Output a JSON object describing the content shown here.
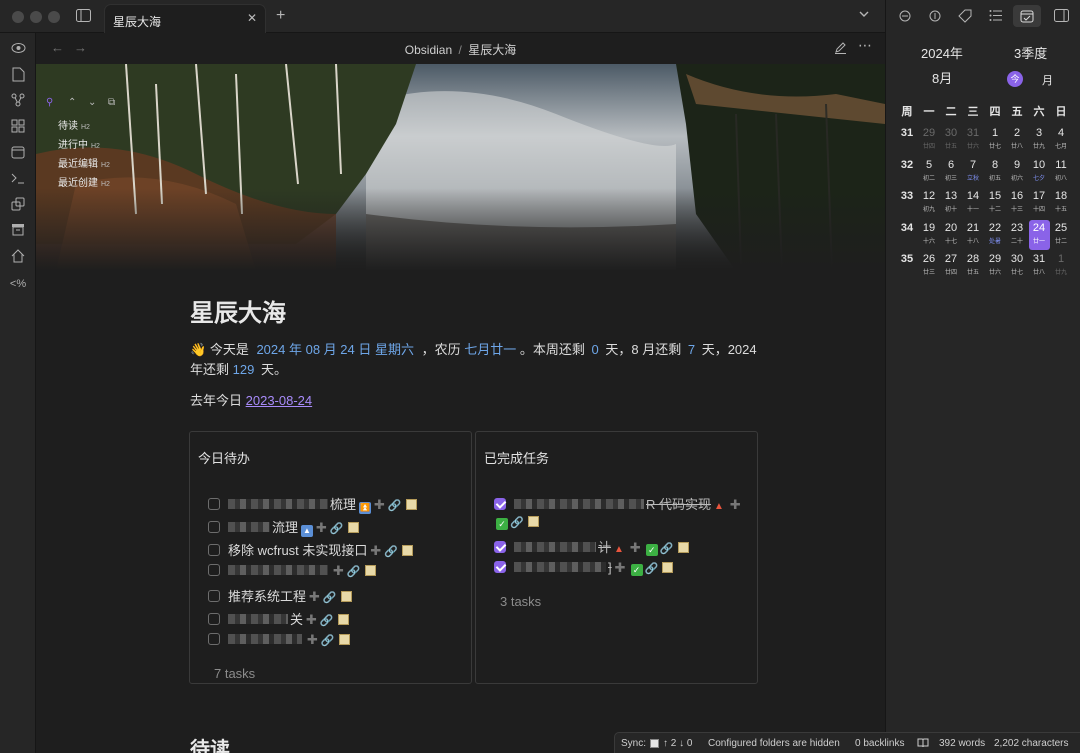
{
  "tab": {
    "title": "星辰大海",
    "close": "✕",
    "new": "+"
  },
  "header": {
    "breadcrumb_parent": "Obsidian",
    "breadcrumb_sep": "/",
    "breadcrumb_current": "星辰大海"
  },
  "outline": {
    "items": [
      {
        "label": "待读",
        "level": "H2"
      },
      {
        "label": "进行中",
        "level": "H2"
      },
      {
        "label": "最近编辑",
        "level": "H2"
      },
      {
        "label": "最近创建",
        "level": "H2"
      }
    ]
  },
  "note": {
    "title": "星辰大海",
    "line1_wave": "👋",
    "line1_a": "今天是",
    "line1_date": "2024 年 08 月 24 日 星期六",
    "line1_b": "，农历",
    "line1_lunar": "七月廿一",
    "line1_c": "。本周还剩",
    "line1_week": "0",
    "line1_d": "天，8 月还剩",
    "line1_month": "7",
    "line1_e": "天，2024",
    "line2_a": "年还剩",
    "line2_year": "129",
    "line2_b": "天。",
    "lastyear_label": "去年今日",
    "lastyear_link": "2023-08-24",
    "next_heading": "待读"
  },
  "todo": {
    "title": "今日待办",
    "tasks": [
      {
        "text": "梳理"
      },
      {
        "text": "流理"
      },
      {
        "text": "移除 wcfrust 未实现接口"
      },
      {
        "text": ""
      },
      {
        "text": "推荐系统工程"
      },
      {
        "text": "关"
      },
      {
        "text": ""
      }
    ],
    "count": "7 tasks"
  },
  "done": {
    "title": "已完成任务",
    "tasks": [
      {
        "text": "R 代码实现"
      },
      {
        "text": "计"
      },
      {
        "text": "]"
      }
    ],
    "count": "3 tasks"
  },
  "calendar": {
    "year": "2024年",
    "quarter": "3季度",
    "month": "8月",
    "today_btn": "今",
    "month_view": "月",
    "weekdays": [
      "周",
      "一",
      "二",
      "三",
      "四",
      "五",
      "六",
      "日"
    ],
    "weeks": [
      {
        "wk": "31",
        "days": [
          [
            "29",
            "廿四",
            1
          ],
          [
            "30",
            "廿五",
            1
          ],
          [
            "31",
            "廿六",
            1
          ],
          [
            "1",
            "廿七",
            0
          ],
          [
            "2",
            "廿八",
            0
          ],
          [
            "3",
            "廿九",
            0
          ],
          [
            "4",
            "七月",
            0
          ]
        ]
      },
      {
        "wk": "32",
        "days": [
          [
            "5",
            "初二",
            0
          ],
          [
            "6",
            "初三",
            0
          ],
          [
            "7",
            "立秋",
            0
          ],
          [
            "8",
            "初五",
            0
          ],
          [
            "9",
            "初六",
            0
          ],
          [
            "10",
            "七夕",
            0
          ],
          [
            "11",
            "初八",
            0
          ]
        ]
      },
      {
        "wk": "33",
        "days": [
          [
            "12",
            "初九",
            0
          ],
          [
            "13",
            "初十",
            0
          ],
          [
            "14",
            "十一",
            0
          ],
          [
            "15",
            "十二",
            0
          ],
          [
            "16",
            "十三",
            0
          ],
          [
            "17",
            "十四",
            0
          ],
          [
            "18",
            "十五",
            0
          ]
        ]
      },
      {
        "wk": "34",
        "days": [
          [
            "19",
            "十六",
            0
          ],
          [
            "20",
            "十七",
            0
          ],
          [
            "21",
            "十八",
            0
          ],
          [
            "22",
            "处暑",
            0
          ],
          [
            "23",
            "二十",
            0
          ],
          [
            "24",
            "廿一",
            0
          ],
          [
            "25",
            "廿二",
            0
          ]
        ]
      },
      {
        "wk": "35",
        "days": [
          [
            "26",
            "廿三",
            0
          ],
          [
            "27",
            "廿四",
            0
          ],
          [
            "28",
            "廿五",
            0
          ],
          [
            "29",
            "廿六",
            0
          ],
          [
            "30",
            "廿七",
            0
          ],
          [
            "31",
            "廿八",
            0
          ],
          [
            "1",
            "廿九",
            1
          ]
        ]
      }
    ],
    "selected_day": "24",
    "accent": "#8a63e8"
  },
  "status": {
    "sync_label": "Sync:",
    "sync_counts": "↑ 2 ↓ 0",
    "folders": "Configured folders are hidden",
    "backlinks": "0 backlinks",
    "words": "392 words",
    "chars": "2,202 characters"
  }
}
